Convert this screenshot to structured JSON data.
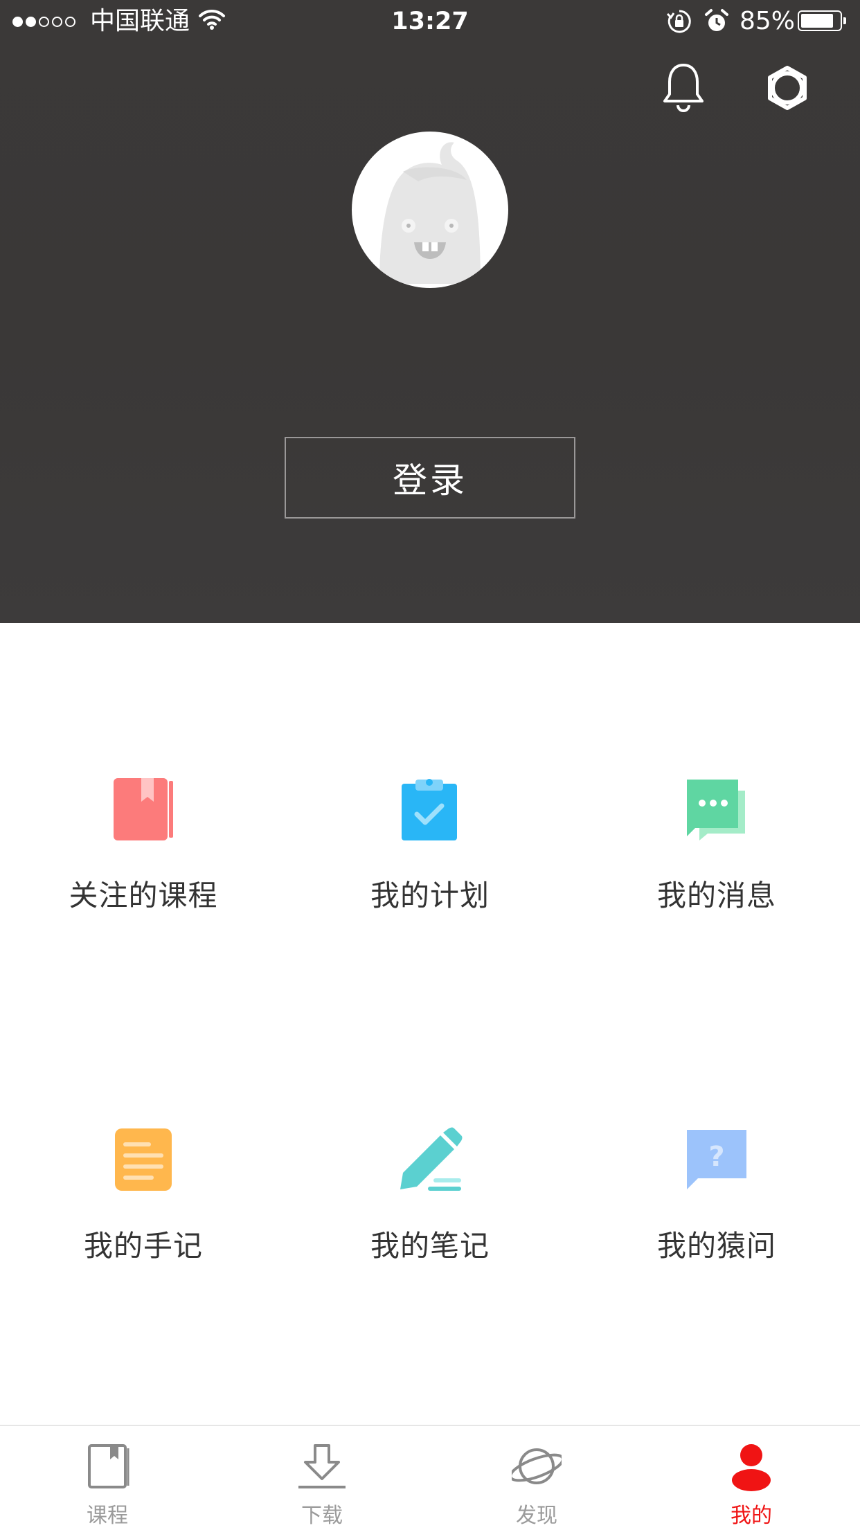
{
  "status_bar": {
    "carrier": "中国联通",
    "time": "13:27",
    "battery": "85%",
    "battery_level": 0.85,
    "signal_bars": 2
  },
  "header": {
    "login_label": "登录",
    "background_color": "#3b3938"
  },
  "menu": {
    "items": [
      {
        "label": "关注的课程",
        "icon": "bookmark-book-icon",
        "color": "#fc7b7b"
      },
      {
        "label": "我的计划",
        "icon": "clipboard-check-icon",
        "color": "#29b6f6"
      },
      {
        "label": "我的消息",
        "icon": "chat-bubbles-icon",
        "color": "#5fd6a2"
      },
      {
        "label": "我的手记",
        "icon": "notepad-icon",
        "color": "#ffb74d"
      },
      {
        "label": "我的笔记",
        "icon": "pencil-icon",
        "color": "#5bd0d0"
      },
      {
        "label": "我的猿问",
        "icon": "question-bubble-icon",
        "color": "#9cc3fb"
      }
    ]
  },
  "tabbar": {
    "tabs": [
      {
        "label": "课程",
        "icon": "book-icon"
      },
      {
        "label": "下载",
        "icon": "download-icon"
      },
      {
        "label": "发现",
        "icon": "planet-icon"
      },
      {
        "label": "我的",
        "icon": "user-icon"
      }
    ],
    "active_index": 3,
    "active_color": "#f01414",
    "inactive_color": "#9b9b9b"
  }
}
